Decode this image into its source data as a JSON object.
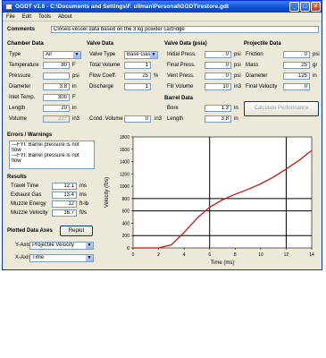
{
  "window": {
    "title": "GGDT v1.6 - C:\\Documents and Settings\\F. ullman\\Personal\\GGDT\\restore.gdt",
    "minimize": "_",
    "maximize": "□",
    "close": "×"
  },
  "menu": [
    "File",
    "Edit",
    "Tools",
    "About"
  ],
  "comments": {
    "label": "Comments",
    "value": "Closed-vessel data based on the 3 kg powder cartridge"
  },
  "chamber": {
    "title": "Chamber Data",
    "type": {
      "label": "Type",
      "value": "Air"
    },
    "rows": [
      {
        "label": "Temperature",
        "value": "80",
        "unit": "F"
      },
      {
        "label": "Pressure",
        "value": "",
        "unit": "psi"
      },
      {
        "label": "Diameter",
        "value": "3.8",
        "unit": "in"
      },
      {
        "label": "Inlet Temp.",
        "value": "300",
        "unit": "F"
      },
      {
        "label": "Length",
        "value": "20",
        "unit": "in"
      },
      {
        "label": "Volume",
        "value": "227",
        "unit": "in3"
      }
    ]
  },
  "valve": {
    "title": "Valve Data",
    "type": {
      "label": "Valve Type",
      "value": "Base Gas"
    },
    "rows": [
      {
        "label": "Total Volume",
        "value": "1",
        "unit": ""
      },
      {
        "label": "Flow Coeff.",
        "value": "25",
        "unit": "%"
      },
      {
        "label": "Discharge",
        "value": "1",
        "unit": ""
      }
    ],
    "cond": {
      "label": "Cond. Volume",
      "value": "0",
      "unit": "in3"
    }
  },
  "valve_psi": {
    "title": "Valve Data (psia)",
    "rows": [
      {
        "label": "Initial Press.",
        "value": "0",
        "unit": "psi"
      },
      {
        "label": "Final Press.",
        "value": "0",
        "unit": "psi"
      },
      {
        "label": "Vent Press.",
        "value": "0",
        "unit": "psi"
      },
      {
        "label": "Fill Volume",
        "value": "10",
        "unit": "in3"
      }
    ]
  },
  "barrel": {
    "title": "Barrel Data",
    "rows": [
      {
        "label": "Bore",
        "value": "1.3",
        "unit": "in"
      },
      {
        "label": "Length",
        "value": "3.8",
        "unit": "in"
      }
    ]
  },
  "projectile": {
    "title": "Projectile Data",
    "rows": [
      {
        "label": "Friction",
        "value": "0",
        "unit": "psi"
      },
      {
        "label": "Mass",
        "value": "25",
        "unit": "gr"
      },
      {
        "label": "Diameter",
        "value": ".125",
        "unit": "in"
      },
      {
        "label": "Final Velocity",
        "value": "0",
        "unit": ""
      }
    ]
  },
  "calc_button": "Calculate Performance",
  "warnings": {
    "title": "Errors / Warnings",
    "lines": [
      "---FYI: Barrel pressure is not",
      "    flow",
      "---FYI: Barrel pressure is not",
      "    flow"
    ]
  },
  "results": {
    "title": "Results",
    "rows": [
      {
        "label": "Travel Time",
        "value": "12.1",
        "unit": "ms"
      },
      {
        "label": "Exhaust Gas",
        "value": "13.4",
        "unit": "ms"
      },
      {
        "label": "Muzzle Energy",
        "value": "12",
        "unit": "ft-lb"
      },
      {
        "label": "Muzzle Velocity",
        "value": "16.7",
        "unit": "ft/s"
      }
    ]
  },
  "plotted": {
    "title": "Plotted Data Axes",
    "replot": "Replot",
    "y": {
      "label": "Y-Axis",
      "value": "Projectile Velocity"
    },
    "x": {
      "label": "X-Axis",
      "value": "Time"
    }
  },
  "chart_data": {
    "type": "line",
    "xlabel": "Time (ms)",
    "ylabel": "Velocity (ft/s)",
    "xlim": [
      0,
      14
    ],
    "ylim": [
      0,
      1800
    ],
    "xticks": [
      "0",
      "2",
      "4",
      "6",
      "8",
      "10",
      "12",
      "14"
    ],
    "yticks": [
      "0",
      "200",
      "400",
      "600",
      "800",
      "1000",
      "1200",
      "1400",
      "1600",
      "1800"
    ],
    "crosshair_x": [
      6,
      12
    ],
    "crosshair_y": [
      200,
      600,
      800
    ],
    "series": [
      {
        "color": "#d4140e",
        "points": [
          [
            0,
            0
          ],
          [
            2,
            0
          ],
          [
            3,
            50
          ],
          [
            4,
            250
          ],
          [
            5,
            480
          ],
          [
            6,
            660
          ],
          [
            7,
            780
          ],
          [
            8,
            870
          ],
          [
            9,
            950
          ],
          [
            10,
            1040
          ],
          [
            11,
            1150
          ],
          [
            12,
            1280
          ],
          [
            13,
            1420
          ],
          [
            14,
            1580
          ]
        ]
      }
    ]
  }
}
